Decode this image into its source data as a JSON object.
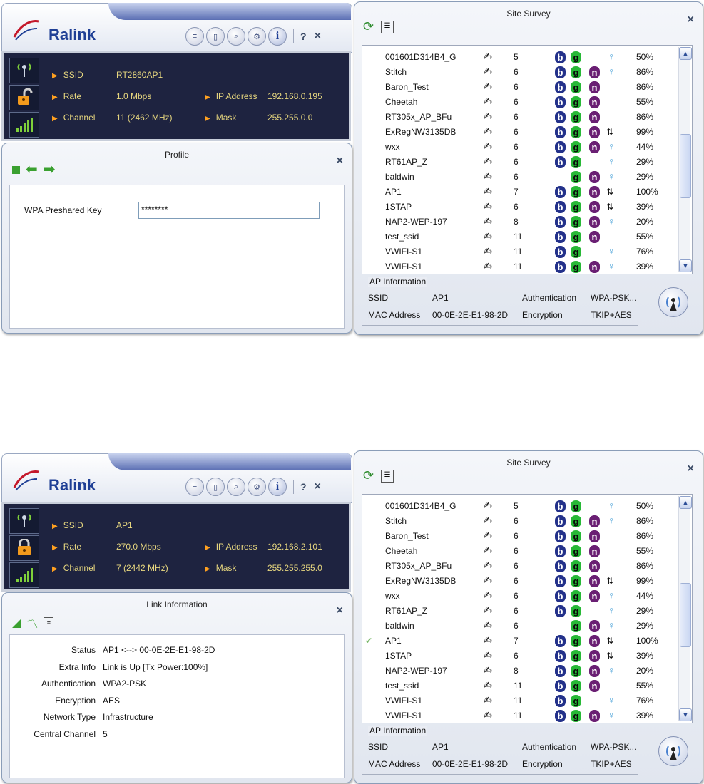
{
  "top": {
    "ralink": {
      "logo": "Ralink",
      "toolbar": {
        "help": "?",
        "close": "×"
      },
      "status": {
        "ssid_label": "SSID",
        "ssid": "RT2860AP1",
        "rate_label": "Rate",
        "rate": "1.0 Mbps",
        "channel_label": "Channel",
        "channel": "11 (2462 MHz)",
        "ip_label": "IP Address",
        "ip": "192.168.0.195",
        "mask_label": "Mask",
        "mask": "255.255.0.0"
      }
    },
    "profile": {
      "title": "Profile",
      "close": "×",
      "field_label": "WPA Preshared Key",
      "field_value": "********"
    },
    "survey": {
      "title": "Site Survey",
      "close": "×",
      "rows": [
        {
          "ssid": "001601D314B4_G",
          "ch": "5",
          "b": true,
          "g": true,
          "n": false,
          "wps": false,
          "key": true,
          "sig": "50%",
          "check": false
        },
        {
          "ssid": "Stitch",
          "ch": "6",
          "b": true,
          "g": true,
          "n": true,
          "wps": false,
          "key": true,
          "sig": "86%",
          "check": false
        },
        {
          "ssid": "Baron_Test",
          "ch": "6",
          "b": true,
          "g": true,
          "n": true,
          "wps": false,
          "key": false,
          "sig": "86%",
          "check": false
        },
        {
          "ssid": "Cheetah",
          "ch": "6",
          "b": true,
          "g": true,
          "n": true,
          "wps": false,
          "key": false,
          "sig": "55%",
          "check": false
        },
        {
          "ssid": "RT305x_AP_BFu",
          "ch": "6",
          "b": true,
          "g": true,
          "n": true,
          "wps": false,
          "key": false,
          "sig": "86%",
          "check": false
        },
        {
          "ssid": "ExRegNW3135DB",
          "ch": "6",
          "b": true,
          "g": true,
          "n": true,
          "wps": true,
          "key": false,
          "sig": "99%",
          "check": false
        },
        {
          "ssid": "wxx",
          "ch": "6",
          "b": true,
          "g": true,
          "n": true,
          "wps": false,
          "key": true,
          "sig": "44%",
          "check": false
        },
        {
          "ssid": "RT61AP_Z",
          "ch": "6",
          "b": true,
          "g": true,
          "n": false,
          "wps": false,
          "key": true,
          "sig": "29%",
          "check": false
        },
        {
          "ssid": "baldwin",
          "ch": "6",
          "b": false,
          "g": true,
          "n": true,
          "wps": false,
          "key": true,
          "sig": "29%",
          "check": false
        },
        {
          "ssid": "AP1",
          "ch": "7",
          "b": true,
          "g": true,
          "n": true,
          "wps": true,
          "key": false,
          "sig": "100%",
          "check": false
        },
        {
          "ssid": "1STAP",
          "ch": "6",
          "b": true,
          "g": true,
          "n": true,
          "wps": true,
          "key": false,
          "sig": "39%",
          "check": false
        },
        {
          "ssid": "NAP2-WEP-197",
          "ch": "8",
          "b": true,
          "g": true,
          "n": true,
          "wps": false,
          "key": true,
          "sig": "20%",
          "check": false
        },
        {
          "ssid": "test_ssid",
          "ch": "11",
          "b": true,
          "g": true,
          "n": true,
          "wps": false,
          "key": false,
          "sig": "55%",
          "check": false
        },
        {
          "ssid": "VWIFI-S1",
          "ch": "11",
          "b": true,
          "g": true,
          "n": false,
          "wps": false,
          "key": true,
          "sig": "76%",
          "check": false
        },
        {
          "ssid": "VWIFI-S1",
          "ch": "11",
          "b": true,
          "g": true,
          "n": true,
          "wps": false,
          "key": true,
          "sig": "39%",
          "check": false
        }
      ],
      "apinfo": {
        "legend": "AP Information",
        "ssid_label": "SSID",
        "ssid": "AP1",
        "mac_label": "MAC Address",
        "mac": "00-0E-2E-E1-98-2D",
        "auth_label": "Authentication",
        "auth": "WPA-PSK...",
        "enc_label": "Encryption",
        "enc": "TKIP+AES"
      }
    }
  },
  "bottom": {
    "ralink": {
      "logo": "Ralink",
      "toolbar": {
        "help": "?",
        "close": "×"
      },
      "status": {
        "ssid_label": "SSID",
        "ssid": "AP1",
        "rate_label": "Rate",
        "rate": "270.0 Mbps",
        "channel_label": "Channel",
        "channel": "7 (2442 MHz)",
        "ip_label": "IP Address",
        "ip": "192.168.2.101",
        "mask_label": "Mask",
        "mask": "255.255.255.0"
      }
    },
    "linkinfo": {
      "title": "Link Information",
      "close": "×",
      "fields": [
        {
          "k": "Status",
          "v": "AP1 <--> 00-0E-2E-E1-98-2D"
        },
        {
          "k": "Extra Info",
          "v": "Link is Up [Tx Power:100%]"
        },
        {
          "k": "Authentication",
          "v": "WPA2-PSK"
        },
        {
          "k": "Encryption",
          "v": "AES"
        },
        {
          "k": "Network Type",
          "v": "Infrastructure"
        },
        {
          "k": "Central Channel",
          "v": "5"
        }
      ]
    },
    "survey": {
      "title": "Site Survey",
      "close": "×",
      "rows": [
        {
          "ssid": "001601D314B4_G",
          "ch": "5",
          "b": true,
          "g": true,
          "n": false,
          "wps": false,
          "key": true,
          "sig": "50%",
          "check": false
        },
        {
          "ssid": "Stitch",
          "ch": "6",
          "b": true,
          "g": true,
          "n": true,
          "wps": false,
          "key": true,
          "sig": "86%",
          "check": false
        },
        {
          "ssid": "Baron_Test",
          "ch": "6",
          "b": true,
          "g": true,
          "n": true,
          "wps": false,
          "key": false,
          "sig": "86%",
          "check": false
        },
        {
          "ssid": "Cheetah",
          "ch": "6",
          "b": true,
          "g": true,
          "n": true,
          "wps": false,
          "key": false,
          "sig": "55%",
          "check": false
        },
        {
          "ssid": "RT305x_AP_BFu",
          "ch": "6",
          "b": true,
          "g": true,
          "n": true,
          "wps": false,
          "key": false,
          "sig": "86%",
          "check": false
        },
        {
          "ssid": "ExRegNW3135DB",
          "ch": "6",
          "b": true,
          "g": true,
          "n": true,
          "wps": true,
          "key": false,
          "sig": "99%",
          "check": false
        },
        {
          "ssid": "wxx",
          "ch": "6",
          "b": true,
          "g": true,
          "n": true,
          "wps": false,
          "key": true,
          "sig": "44%",
          "check": false
        },
        {
          "ssid": "RT61AP_Z",
          "ch": "6",
          "b": true,
          "g": true,
          "n": false,
          "wps": false,
          "key": true,
          "sig": "29%",
          "check": false
        },
        {
          "ssid": "baldwin",
          "ch": "6",
          "b": false,
          "g": true,
          "n": true,
          "wps": false,
          "key": true,
          "sig": "29%",
          "check": false
        },
        {
          "ssid": "AP1",
          "ch": "7",
          "b": true,
          "g": true,
          "n": true,
          "wps": true,
          "key": false,
          "sig": "100%",
          "check": true
        },
        {
          "ssid": "1STAP",
          "ch": "6",
          "b": true,
          "g": true,
          "n": true,
          "wps": true,
          "key": false,
          "sig": "39%",
          "check": false
        },
        {
          "ssid": "NAP2-WEP-197",
          "ch": "8",
          "b": true,
          "g": true,
          "n": true,
          "wps": false,
          "key": true,
          "sig": "20%",
          "check": false
        },
        {
          "ssid": "test_ssid",
          "ch": "11",
          "b": true,
          "g": true,
          "n": true,
          "wps": false,
          "key": false,
          "sig": "55%",
          "check": false
        },
        {
          "ssid": "VWIFI-S1",
          "ch": "11",
          "b": true,
          "g": true,
          "n": false,
          "wps": false,
          "key": true,
          "sig": "76%",
          "check": false
        },
        {
          "ssid": "VWIFI-S1",
          "ch": "11",
          "b": true,
          "g": true,
          "n": true,
          "wps": false,
          "key": true,
          "sig": "39%",
          "check": false
        }
      ],
      "apinfo": {
        "legend": "AP Information",
        "ssid_label": "SSID",
        "ssid": "AP1",
        "mac_label": "MAC Address",
        "mac": "00-0E-2E-E1-98-2D",
        "auth_label": "Authentication",
        "auth": "WPA-PSK...",
        "enc_label": "Encryption",
        "enc": "TKIP+AES"
      }
    }
  }
}
